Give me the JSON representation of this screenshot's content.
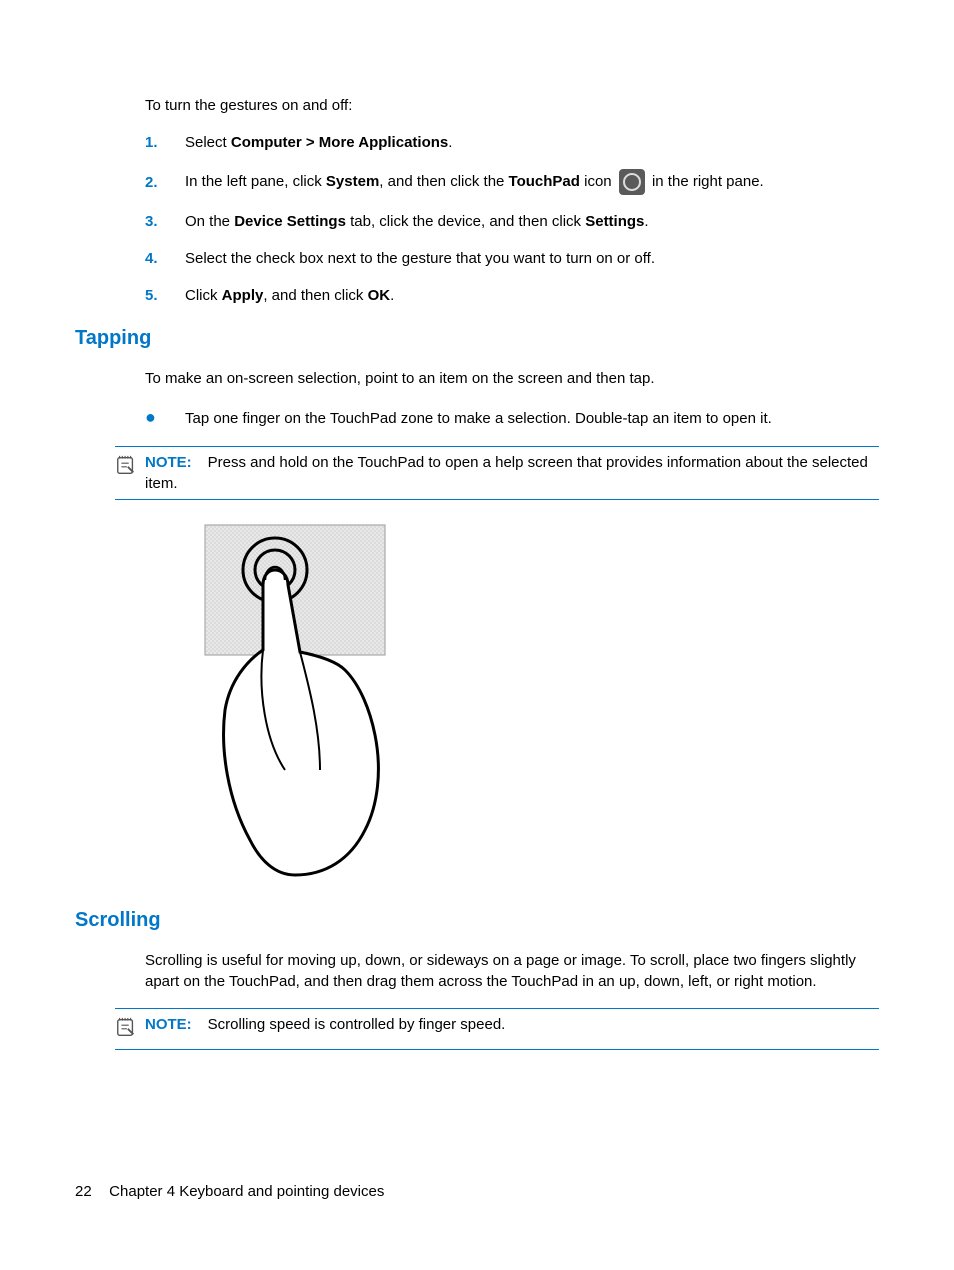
{
  "intro": "To turn the gestures on and off:",
  "steps": [
    {
      "num": "1.",
      "prefix": "Select ",
      "bold1": "Computer > More Applications",
      "suffix": "."
    },
    {
      "num": "2.",
      "prefix": "In the left pane, click ",
      "bold1": "System",
      "mid1": ", and then click the ",
      "bold2": "TouchPad",
      "mid2": " icon ",
      "icon": true,
      "suffix": " in the right pane."
    },
    {
      "num": "3.",
      "prefix": "On the ",
      "bold1": "Device Settings",
      "mid1": " tab, click the device, and then click ",
      "bold2": "Settings",
      "suffix": "."
    },
    {
      "num": "4.",
      "prefix": "Select the check box next to the gesture that you want to turn on or off."
    },
    {
      "num": "5.",
      "prefix": "Click ",
      "bold1": "Apply",
      "mid1": ", and then click ",
      "bold2": "OK",
      "suffix": "."
    }
  ],
  "tapping": {
    "heading": "Tapping",
    "body": "To make an on-screen selection, point to an item on the screen and then tap.",
    "bullet": "Tap one finger on the TouchPad zone to make a selection. Double-tap an item to open it.",
    "note_label": "NOTE:",
    "note_text": "Press and hold on the TouchPad to open a help screen that provides information about the selected item."
  },
  "scrolling": {
    "heading": "Scrolling",
    "body": "Scrolling is useful for moving up, down, or sideways on a page or image. To scroll, place two fingers slightly apart on the TouchPad, and then drag them across the TouchPad in an up, down, left, or right motion.",
    "note_label": "NOTE:",
    "note_text": "Scrolling speed is controlled by finger speed."
  },
  "footer": {
    "page": "22",
    "chapter": "Chapter 4   Keyboard and pointing devices"
  }
}
